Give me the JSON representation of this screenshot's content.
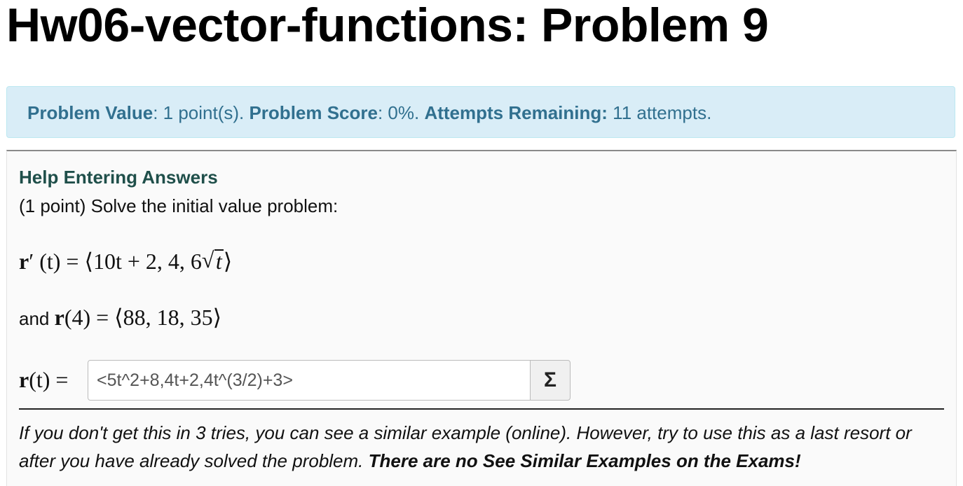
{
  "page": {
    "title": "Hw06-vector-functions: Problem 9"
  },
  "info": {
    "value_label": "Problem Value",
    "value_text": ": 1 point(s). ",
    "score_label": "Problem Score",
    "score_text": ": 0%. ",
    "attempts_label": "Attempts Remaining:",
    "attempts_text": " 11 attempts."
  },
  "problem": {
    "help_link": "Help Entering Answers",
    "intro": "(1 point) Solve the initial value problem:",
    "eq1": {
      "lhs": "r",
      "prime_t": "′ (t) = ⟨10t + 2, 4, 6",
      "sqrt_arg": "t",
      "close": "⟩"
    },
    "eq2": {
      "and": "and ",
      "r": "r",
      "rest": "(4) = ⟨88, 18, 35⟩"
    },
    "answer": {
      "label_r": "r",
      "label_rest": "(t) =",
      "value": "<5t^2+8,4t+2,4t^(3/2)+3>",
      "sigma_label": "Σ"
    },
    "note_italic": "If you don't get this in 3 tries, you can see a similar example (online). However, try to use this as a last resort or after you have already solved the problem. ",
    "note_bold": "There are no See Similar Examples on the Exams!"
  }
}
